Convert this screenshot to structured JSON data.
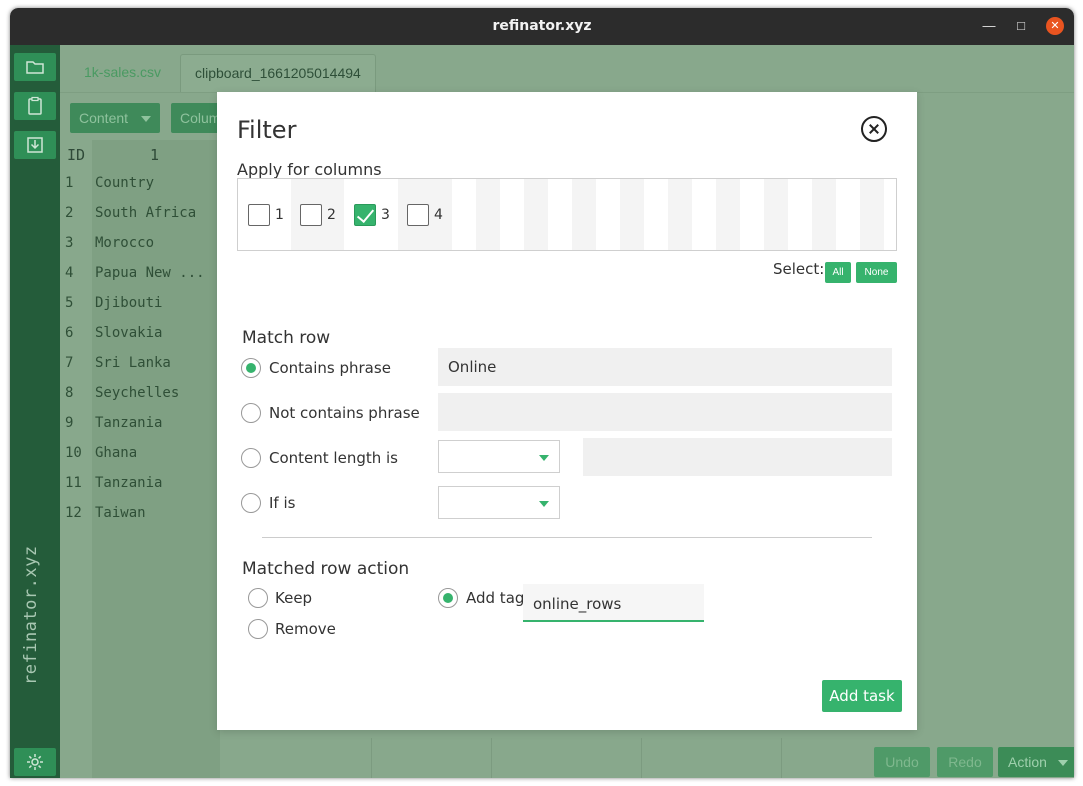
{
  "window": {
    "title": "refinator.xyz"
  },
  "sidebar": {
    "vertical_label": "refinator.xyz",
    "icons": [
      "folder-icon",
      "clipboard-icon",
      "download-icon",
      "gear-icon"
    ]
  },
  "tabs": [
    {
      "label": "1k-sales.csv"
    },
    {
      "label": "clipboard_1661205014494"
    }
  ],
  "toolbar": {
    "content_label": "Content",
    "columns_label": "Colum"
  },
  "grid": {
    "headers": {
      "id": "ID",
      "col1": "1"
    },
    "rows": [
      {
        "id": "1",
        "value": "Country"
      },
      {
        "id": "2",
        "value": "South Africa"
      },
      {
        "id": "3",
        "value": "Morocco"
      },
      {
        "id": "4",
        "value": "Papua New ..."
      },
      {
        "id": "5",
        "value": "Djibouti"
      },
      {
        "id": "6",
        "value": "Slovakia"
      },
      {
        "id": "7",
        "value": "Sri Lanka"
      },
      {
        "id": "8",
        "value": "Seychelles"
      },
      {
        "id": "9",
        "value": "Tanzania"
      },
      {
        "id": "10",
        "value": "Ghana"
      },
      {
        "id": "11",
        "value": "Tanzania"
      },
      {
        "id": "12",
        "value": "Taiwan"
      }
    ]
  },
  "bottom": {
    "undo": "Undo",
    "redo": "Redo",
    "action": "Action"
  },
  "filter": {
    "title": "Filter",
    "apply_label": "Apply for columns",
    "columns": [
      {
        "label": "1",
        "checked": false
      },
      {
        "label": "2",
        "checked": false
      },
      {
        "label": "3",
        "checked": true
      },
      {
        "label": "4",
        "checked": false
      }
    ],
    "select_label": "Select:",
    "all_label": "All",
    "none_label": "None",
    "match_row": {
      "heading": "Match row",
      "contains_phrase": {
        "label": "Contains phrase",
        "value": "Online",
        "selected": true
      },
      "not_contains_phrase": {
        "label": "Not contains phrase",
        "value": ""
      },
      "content_length": {
        "label": "Content length is",
        "value": ""
      },
      "if_is": {
        "label": "If is"
      }
    },
    "matched_action": {
      "heading": "Matched row action",
      "keep": "Keep",
      "remove": "Remove",
      "add_tag": "Add tag",
      "tag_value": "online_rows",
      "selected": "add_tag"
    },
    "add_task_label": "Add task"
  },
  "colors": {
    "accent": "#36b36d",
    "sidebar": "#245c3a",
    "overlay": "#88a88c"
  }
}
